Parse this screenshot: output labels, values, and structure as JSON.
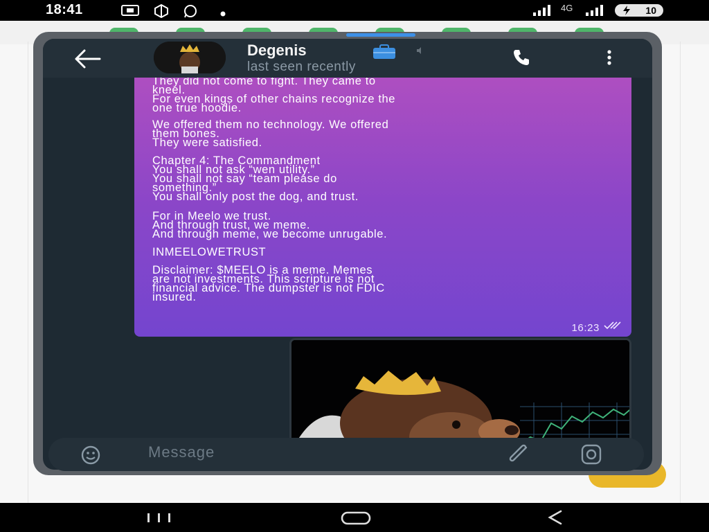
{
  "status_bar": {
    "time": "18:41",
    "network_label": "4G",
    "battery": "10",
    "icons": [
      "screen-recorder-icon",
      "app-icon",
      "whatsapp-icon",
      "dot-icon",
      "signal-icon",
      "battery-icon"
    ]
  },
  "chat": {
    "contact_name": "Degenis",
    "last_seen": "last seen recently",
    "message_paragraphs": [
      "Duck.\nThey did not come to fight. They came to\nkneel.\nFor even kings of other chains recognize the\none true hoodie.",
      "We offered them no technology. We offered\nthem bones.\nThey were satisfied.",
      "Chapter 4: The Commandment\nYou shall not ask “wen utility.”\nYou shall not say “team please do\nsomething.”\nYou shall only post the dog, and trust.",
      "For in Meelo we trust.\nAnd through trust, we meme.\nAnd through meme, we become unrugable.",
      "INMEELOWETRUST",
      "Disclaimer: $MEELO is a meme. Memes\nare not investments. This scripture is not\nfinancial advice. The dumpster is not FDIC\ninsured."
    ],
    "message_time": "16:23",
    "input_placeholder": "Message"
  },
  "colors": {
    "bubble_top": "#b04fc0",
    "bubble_bottom": "#7445cf",
    "chat_background": "#1e2a33",
    "header": "#243039"
  }
}
